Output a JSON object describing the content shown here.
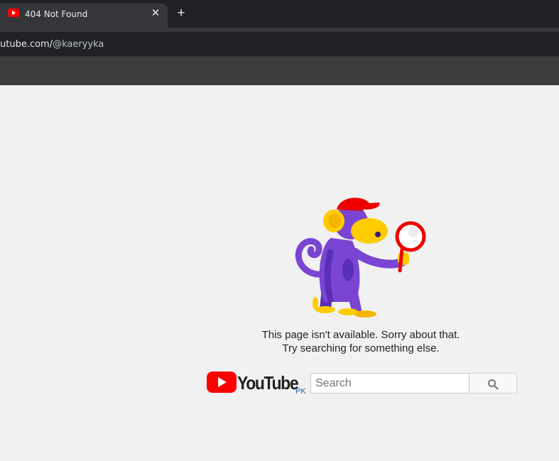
{
  "browser": {
    "tab": {
      "title": "404 Not Found",
      "favicon": "youtube-favicon-icon",
      "close_icon": "close-icon"
    },
    "new_tab_icon": "plus-icon",
    "address": {
      "host_tail": "utube.com/",
      "path": "@kaeryyka"
    }
  },
  "page": {
    "illustration": "monkey-with-magnifier",
    "message_line1": "This page isn't available. Sorry about that.",
    "message_line2": "Try searching for something else.",
    "logo": {
      "wordmark": "YouTube",
      "country_code": "PK",
      "brand_color": "#ff0000"
    },
    "search": {
      "placeholder": "Search",
      "value": "",
      "button_icon": "search-icon"
    }
  }
}
